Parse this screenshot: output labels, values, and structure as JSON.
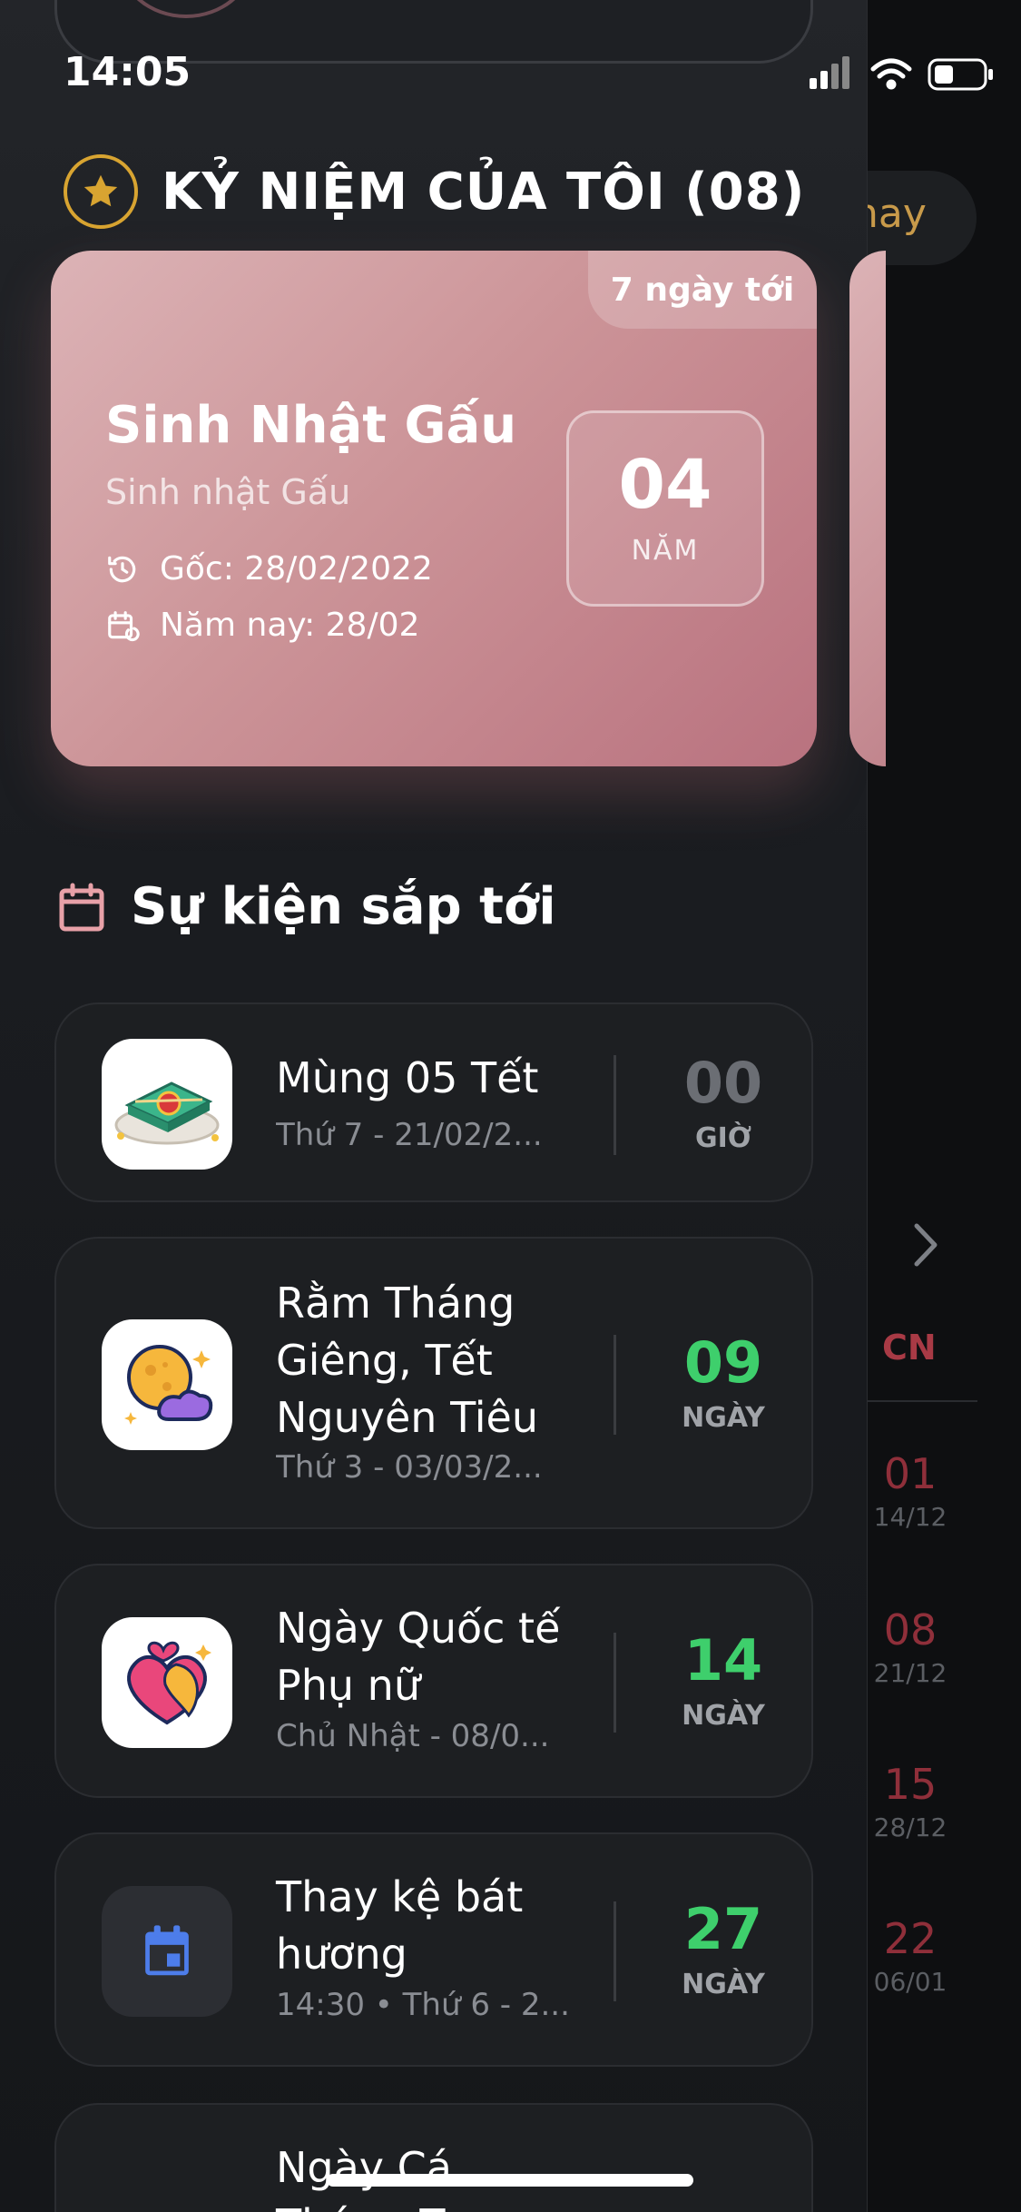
{
  "status_bar": {
    "time": "14:05"
  },
  "background": {
    "today_button": "nay",
    "weekday_header": "CN",
    "dates": [
      {
        "day": "01",
        "lunar": "14/12"
      },
      {
        "day": "08",
        "lunar": "21/12"
      },
      {
        "day": "15",
        "lunar": "28/12"
      },
      {
        "day": "22",
        "lunar": "06/01"
      }
    ]
  },
  "anniversaries": {
    "title": "KỶ NIỆM CỦA TÔI (08)",
    "card": {
      "badge": "7 ngày tới",
      "name": "Sinh Nhật Gấu",
      "subtitle": "Sinh nhật Gấu",
      "origin": "Gốc: 28/02/2022",
      "this_year": "Năm nay: 28/02",
      "count": "04",
      "unit": "NĂM"
    }
  },
  "upcoming": {
    "title": "Sự kiện sắp tới",
    "events": [
      {
        "title": "Mùng 05 Tết",
        "subtitle": "Thứ 7 - 21/02/2...",
        "count": "00",
        "unit": "GIỜ",
        "icon": "tet-cake-icon",
        "count_color": "#6b6e74"
      },
      {
        "title": "Rằm Tháng Giêng, Tết Nguyên Tiêu",
        "subtitle": "Thứ 3 - 03/03/2...",
        "count": "09",
        "unit": "NGÀY",
        "icon": "full-moon-icon",
        "count_color": "#3ecf6c"
      },
      {
        "title": "Ngày Quốc tế Phụ nữ",
        "subtitle": "Chủ Nhật - 08/0...",
        "count": "14",
        "unit": "NGÀY",
        "icon": "women-day-icon",
        "count_color": "#3ecf6c"
      },
      {
        "title": "Thay kệ bát hương",
        "subtitle": "14:30 • Thứ 6 - 2...",
        "count": "27",
        "unit": "NGÀY",
        "icon": "calendar-icon",
        "count_color": "#3ecf6c"
      },
      {
        "title": "Ngày Cá Tháng T",
        "subtitle": "",
        "count": "",
        "unit": "",
        "icon": "",
        "count_color": "#3ecf6c"
      }
    ]
  },
  "colors": {
    "accent_gold": "#d8a431",
    "count_green": "#3ecf6c",
    "weekend_red": "#a83a45"
  }
}
